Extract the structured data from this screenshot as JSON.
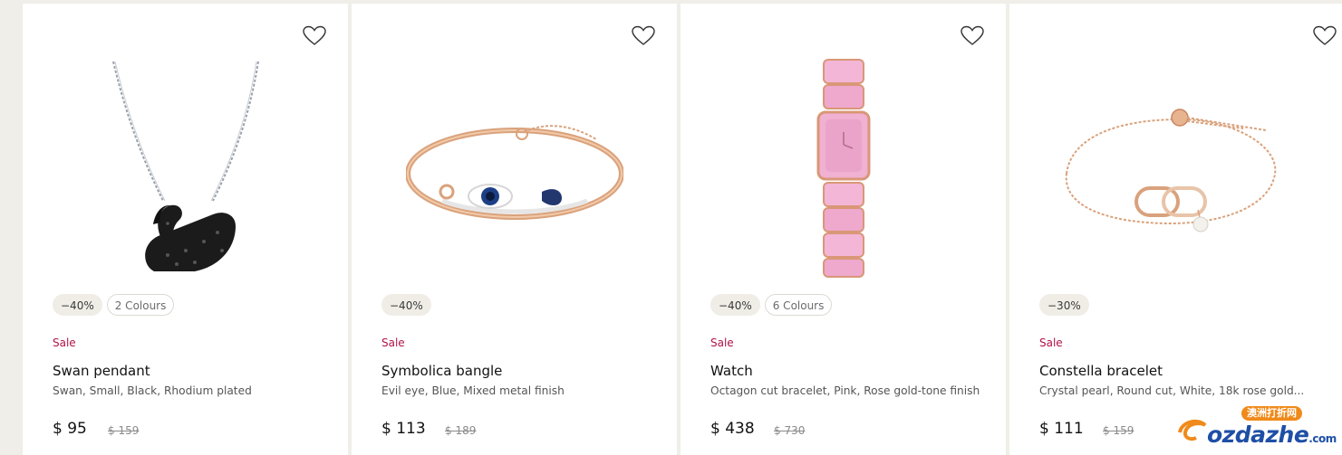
{
  "products": [
    {
      "wishlist_icon": "heart-outline-icon",
      "discount": "−40%",
      "colours": "2 Colours",
      "sale": "Sale",
      "name": "Swan pendant",
      "description": "Swan, Small, Black, Rhodium plated",
      "price": "$ 95",
      "old_price": "$ 159",
      "image": "swan-pendant-necklace"
    },
    {
      "wishlist_icon": "heart-outline-icon",
      "discount": "−40%",
      "colours": "",
      "sale": "Sale",
      "name": "Symbolica bangle",
      "description": "Evil eye, Blue, Mixed metal finish",
      "price": "$ 113",
      "old_price": "$ 189",
      "image": "evil-eye-bangle"
    },
    {
      "wishlist_icon": "heart-outline-icon",
      "discount": "−40%",
      "colours": "6 Colours",
      "sale": "Sale",
      "name": "Watch",
      "description": "Octagon cut bracelet, Pink, Rose gold-tone finish",
      "price": "$ 438",
      "old_price": "$ 730",
      "image": "pink-crystal-watch"
    },
    {
      "wishlist_icon": "heart-outline-icon",
      "discount": "−30%",
      "colours": "",
      "sale": "Sale",
      "name": "Constella bracelet",
      "description": "Crystal pearl, Round cut, White, 18k rose gold...",
      "price": "$ 111",
      "old_price": "$ 159",
      "image": "constella-bracelet"
    }
  ],
  "watermark": {
    "text": "ozdazhe",
    "suffix": ".com",
    "banner": "澳洲打折网"
  },
  "colors": {
    "sale": "#b1124a",
    "page_background": "#efeee9",
    "card_background": "#ffffff"
  }
}
